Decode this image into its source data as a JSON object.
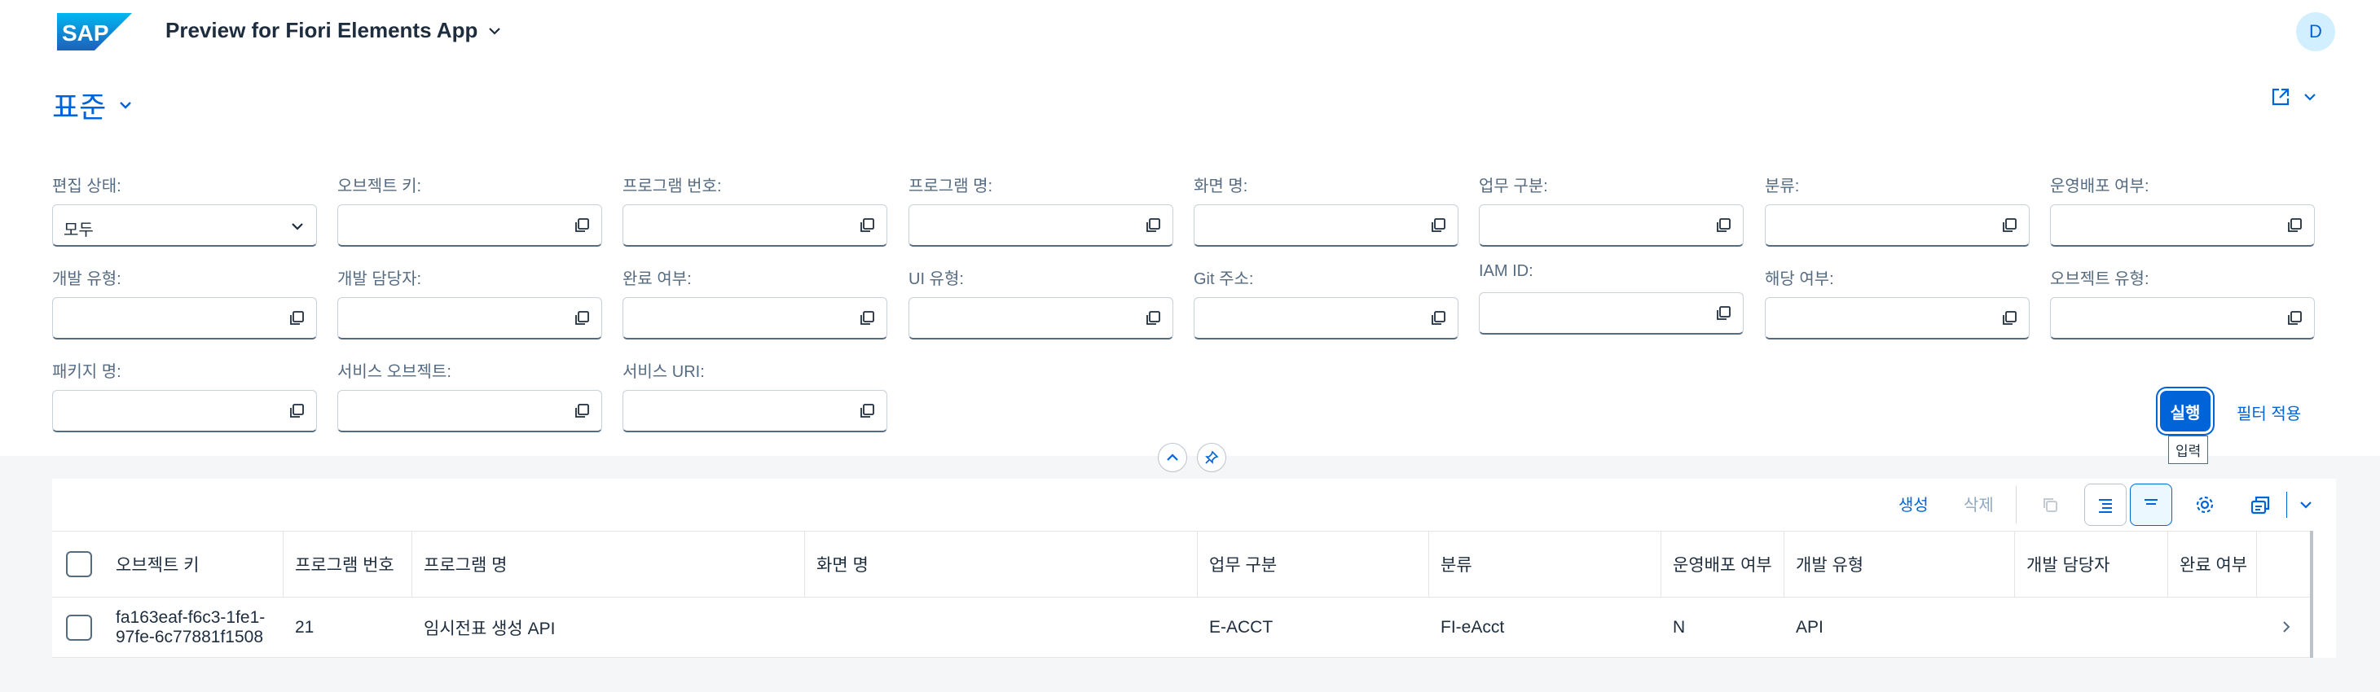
{
  "shell": {
    "app_title": "Preview for Fiori Elements App",
    "avatar_initial": "D",
    "logo_text": "SAP"
  },
  "variant": {
    "name": "표준"
  },
  "filters": [
    {
      "label": "편집 상태:",
      "value": "모두",
      "type": "select"
    },
    {
      "label": "오브젝트 키:",
      "value": ""
    },
    {
      "label": "프로그램 번호:",
      "value": ""
    },
    {
      "label": "프로그램 명:",
      "value": ""
    },
    {
      "label": "화면 명:",
      "value": ""
    },
    {
      "label": "업무 구분:",
      "value": ""
    },
    {
      "label": "분류:",
      "value": ""
    },
    {
      "label": "운영배포 여부:",
      "value": ""
    },
    {
      "label": "개발 유형:",
      "value": ""
    },
    {
      "label": "개발 담당자:",
      "value": ""
    },
    {
      "label": "완료 여부:",
      "value": ""
    },
    {
      "label": "UI 유형:",
      "value": ""
    },
    {
      "label": "Git 주소:",
      "value": ""
    },
    {
      "label": "IAM ID:",
      "value": ""
    },
    {
      "label": "해당 여부:",
      "value": ""
    },
    {
      "label": "오브젝트 유형:",
      "value": ""
    },
    {
      "label": "패키지 명:",
      "value": ""
    },
    {
      "label": "서비스 오브젝트:",
      "value": ""
    },
    {
      "label": "서비스 URI:",
      "value": ""
    }
  ],
  "filterbar": {
    "go_label": "실행",
    "go_tooltip": "입력",
    "adapt_label": "필터 적용"
  },
  "table": {
    "toolbar": {
      "create_label": "생성",
      "delete_label": "삭제"
    },
    "columns": [
      "오브젝트 키",
      "프로그램 번호",
      "프로그램 명",
      "화면 명",
      "업무 구분",
      "분류",
      "운영배포 여부",
      "개발 유형",
      "개발 담당자",
      "완료 여부"
    ],
    "rows": [
      {
        "object_key_line1": "fa163eaf-f6c3-1fe1-",
        "object_key_line2": "97fe-6c77881f1508",
        "program_no": "21",
        "program_name": "임시전표 생성 API",
        "screen_name": "",
        "business": "E-ACCT",
        "category": "FI-eAcct",
        "deploy": "N",
        "dev_type": "API",
        "developer": "",
        "done": ""
      }
    ]
  },
  "colors": {
    "accent": "#0064d9",
    "text": "#1d2d3e",
    "label": "#556b82",
    "background": "#f5f6f7"
  }
}
